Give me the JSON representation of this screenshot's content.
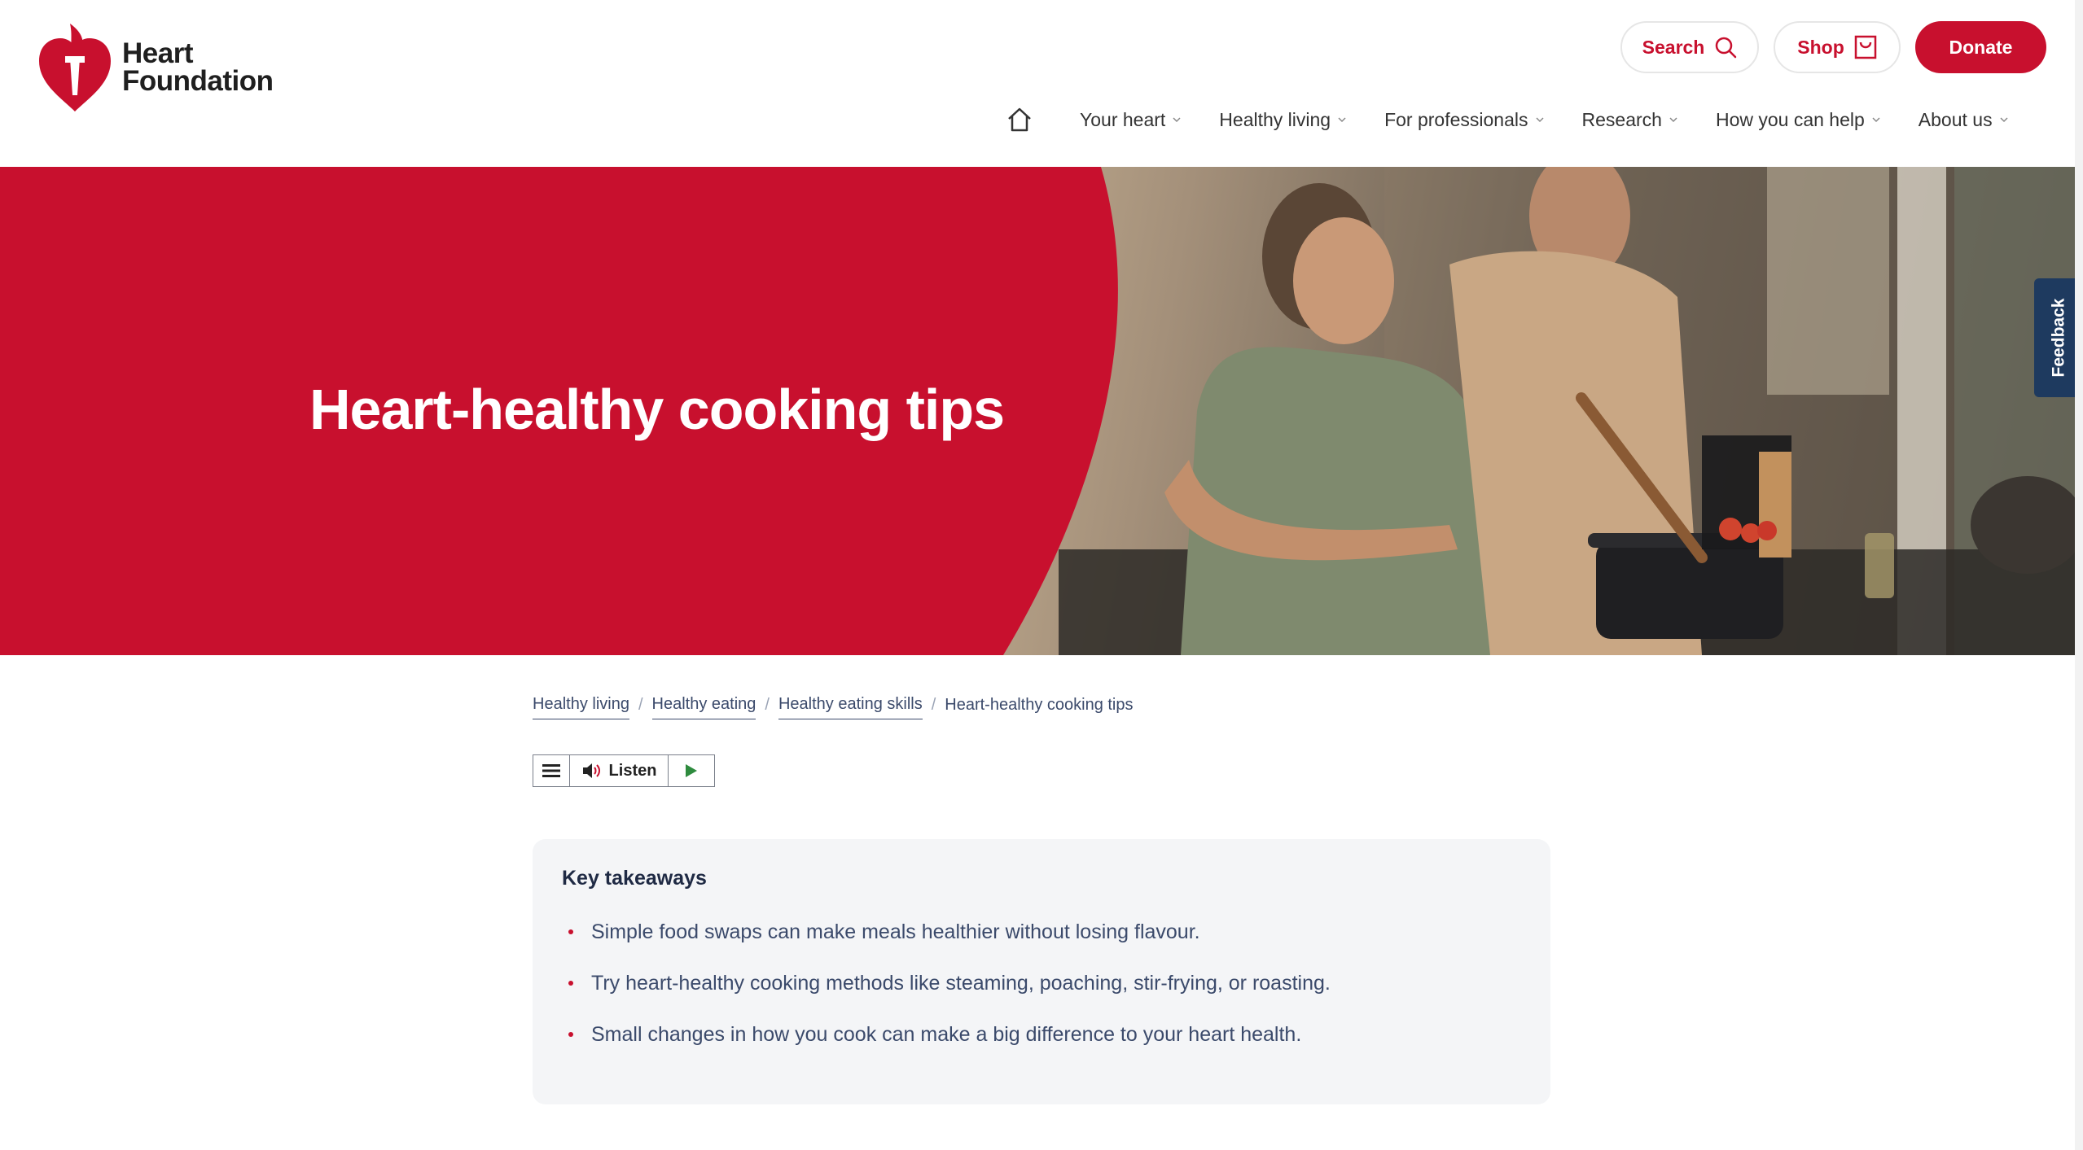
{
  "brand": {
    "name_line1": "Heart",
    "name_line2": "Foundation",
    "primary_color": "#c8102e"
  },
  "header_actions": {
    "search_label": "Search",
    "shop_label": "Shop",
    "donate_label": "Donate"
  },
  "nav": {
    "home_icon": "home-icon",
    "items": [
      {
        "label": "Your heart"
      },
      {
        "label": "Healthy living"
      },
      {
        "label": "For professionals"
      },
      {
        "label": "Research"
      },
      {
        "label": "How you can help"
      },
      {
        "label": "About us"
      }
    ]
  },
  "hero": {
    "title": "Heart-healthy cooking tips",
    "panel_color": "#c8102e"
  },
  "feedback": {
    "label": "Feedback"
  },
  "breadcrumb": {
    "links": [
      "Healthy living",
      "Healthy eating",
      "Healthy eating skills"
    ],
    "current": "Heart-healthy cooking tips"
  },
  "listen": {
    "label": "Listen"
  },
  "takeaways": {
    "heading": "Key takeaways",
    "items": [
      "Simple food swaps can make meals healthier without losing flavour.",
      "Try heart-healthy cooking methods like steaming, poaching, stir-frying, or roasting.",
      "Small changes in how you cook can make a big difference to your heart health."
    ]
  }
}
